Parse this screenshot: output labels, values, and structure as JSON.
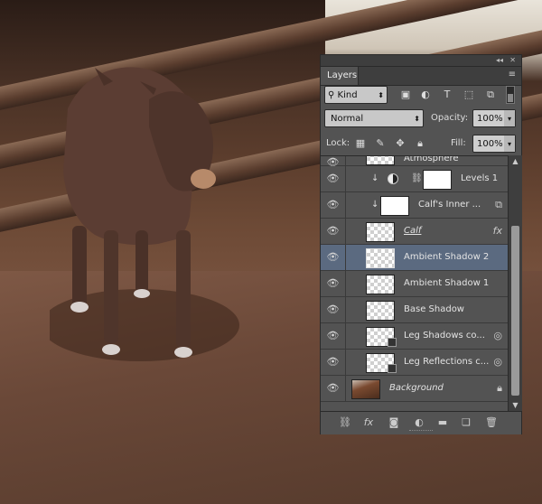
{
  "panel": {
    "tab_label": "Layers",
    "collapse_glyph": "◂◂",
    "close_glyph": "✕",
    "menu_glyph": "≡"
  },
  "filter": {
    "kind_label": "Kind",
    "icons": [
      "image-filter-icon",
      "adjustment-filter-icon",
      "type-filter-icon",
      "shape-filter-icon",
      "smart-object-filter-icon"
    ]
  },
  "blend": {
    "mode": "Normal",
    "opacity_label": "Opacity:",
    "opacity_value": "100%"
  },
  "lock": {
    "label": "Lock:",
    "fill_label": "Fill:",
    "fill_value": "100%"
  },
  "layers": [
    {
      "name": "Atmosphere",
      "type": "partial",
      "visible": true
    },
    {
      "name": "Levels 1",
      "type": "adjustment",
      "clipped": true,
      "visible": true
    },
    {
      "name": "Calf's Inner ...",
      "type": "smart",
      "clipped": true,
      "visible": true
    },
    {
      "name": "Calf",
      "type": "pixel",
      "fx": true,
      "underline": true,
      "italic": true,
      "visible": true
    },
    {
      "name": "Ambient Shadow 2",
      "type": "pixel",
      "selected": true,
      "visible": true
    },
    {
      "name": "Ambient Shadow 1",
      "type": "pixel",
      "visible": true
    },
    {
      "name": "Base Shadow",
      "type": "pixel",
      "visible": true
    },
    {
      "name": "Leg Shadows co...",
      "type": "smart-effects",
      "visible": true
    },
    {
      "name": "Leg Reflections c...",
      "type": "smart-effects",
      "visible": true
    },
    {
      "name": "Background",
      "type": "background",
      "italic": true,
      "locked": true,
      "visible": true
    }
  ],
  "footer": {
    "icons": [
      "link-icon",
      "fx-icon",
      "mask-icon",
      "adjustment-icon",
      "folder-icon",
      "new-layer-icon",
      "trash-icon"
    ],
    "fx_label": "fx"
  },
  "colors": {
    "panel_bg": "#535353",
    "selected_row": "#5b6a80",
    "header_bg": "#3e3e3e"
  }
}
